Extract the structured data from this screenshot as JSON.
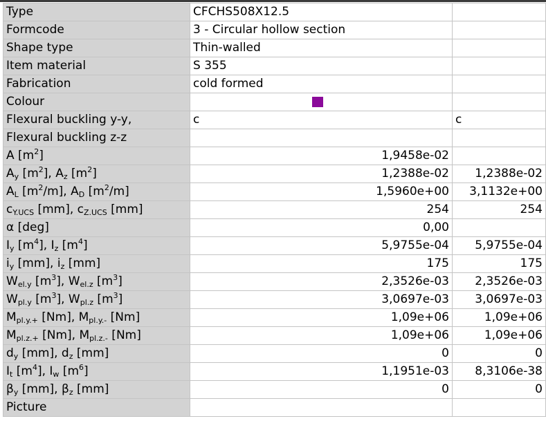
{
  "colors": {
    "swatch": "#8b0a9a",
    "label_bg": "#d3d3d3",
    "grid_line": "#c4c4c4"
  },
  "rows": {
    "type": {
      "label": "Type",
      "v1": "CFCHS508X12.5",
      "v2": ""
    },
    "formcode": {
      "label": "Formcode",
      "v1": "3 - Circular hollow section",
      "v2": ""
    },
    "shape_type": {
      "label": "Shape type",
      "v1": "Thin-walled",
      "v2": ""
    },
    "item_material": {
      "label": "Item material",
      "v1": "S 355",
      "v2": ""
    },
    "fabrication": {
      "label": "Fabrication",
      "v1": "cold formed",
      "v2": ""
    },
    "colour": {
      "label": "Colour"
    },
    "flex_y": {
      "label": "Flexural buckling y-y,",
      "v1": "c",
      "v2": "c"
    },
    "flex_z": {
      "label": "Flexural buckling z-z",
      "v1": "",
      "v2": ""
    },
    "area": {
      "a": "A [m",
      "b": "2",
      "c": "]",
      "v1": "1,9458e-02",
      "v2": ""
    },
    "shear_area": {
      "a": "A",
      "as": "y",
      "b": " [m",
      "bs": "2",
      "c": "], A",
      "cs": "z",
      "d": " [m",
      "ds": "2",
      "e": "]",
      "v1": "1,2388e-02",
      "v2": "1,2388e-02"
    },
    "surface": {
      "a": "A",
      "as": "L",
      "b": " [m",
      "bs": "2",
      "c": "/m], A",
      "cs": "D",
      "d": " [m",
      "ds": "2",
      "e": "/m]",
      "v1": "1,5960e+00",
      "v2": "3,1132e+00"
    },
    "centroid": {
      "a": "c",
      "as": "Y.UCS",
      "b": " [mm], c",
      "bs": "Z.UCS",
      "c": " [mm]",
      "v1": "254",
      "v2": "254"
    },
    "alpha": {
      "label": "α [deg]",
      "v1": "0,00",
      "v2": ""
    },
    "inertia": {
      "a": "I",
      "as": "y",
      "b": " [m",
      "bs": "4",
      "c": "], I",
      "cs": "z",
      "d": " [m",
      "ds": "4",
      "e": "]",
      "v1": "5,9755e-04",
      "v2": "5,9755e-04"
    },
    "radius": {
      "a": "i",
      "as": "y",
      "b": " [mm], i",
      "bs": "z",
      "c": " [mm]",
      "v1": "175",
      "v2": "175"
    },
    "wel": {
      "a": "W",
      "as": "el.y",
      "b": " [m",
      "bs": "3",
      "c": "], W",
      "cs": "el.z",
      "d": " [m",
      "ds": "3",
      "e": "]",
      "v1": "2,3526e-03",
      "v2": "2,3526e-03"
    },
    "wpl": {
      "a": "W",
      "as": "pl.y",
      "b": " [m",
      "bs": "3",
      "c": "], W",
      "cs": "pl.z",
      "d": " [m",
      "ds": "3",
      "e": "]",
      "v1": "3,0697e-03",
      "v2": "3,0697e-03"
    },
    "mply": {
      "a": "M",
      "as": "pl.y.+",
      "b": " [Nm], M",
      "bs": "pl.y.-",
      "c": " [Nm]",
      "v1": "1,09e+06",
      "v2": "1,09e+06"
    },
    "mplz": {
      "a": "M",
      "as": "pl.z.+",
      "b": " [Nm], M",
      "bs": "pl.z.-",
      "c": " [Nm]",
      "v1": "1,09e+06",
      "v2": "1,09e+06"
    },
    "shear_center": {
      "a": "d",
      "as": "y",
      "b": " [mm], d",
      "bs": "z",
      "c": " [mm]",
      "v1": "0",
      "v2": "0"
    },
    "torsion": {
      "a": "I",
      "as": "t",
      "b": " [m",
      "bs": "4",
      "c": "], I",
      "cs": "w",
      "d": " [m",
      "ds": "6",
      "e": "]",
      "v1": "1,1951e-03",
      "v2": "8,3106e-38"
    },
    "beta": {
      "a": "β",
      "as": "y",
      "b": " [mm], β",
      "bs": "z",
      "c": " [mm]",
      "v1": "0",
      "v2": "0"
    },
    "picture": {
      "label": "Picture",
      "v1": "",
      "v2": ""
    }
  }
}
